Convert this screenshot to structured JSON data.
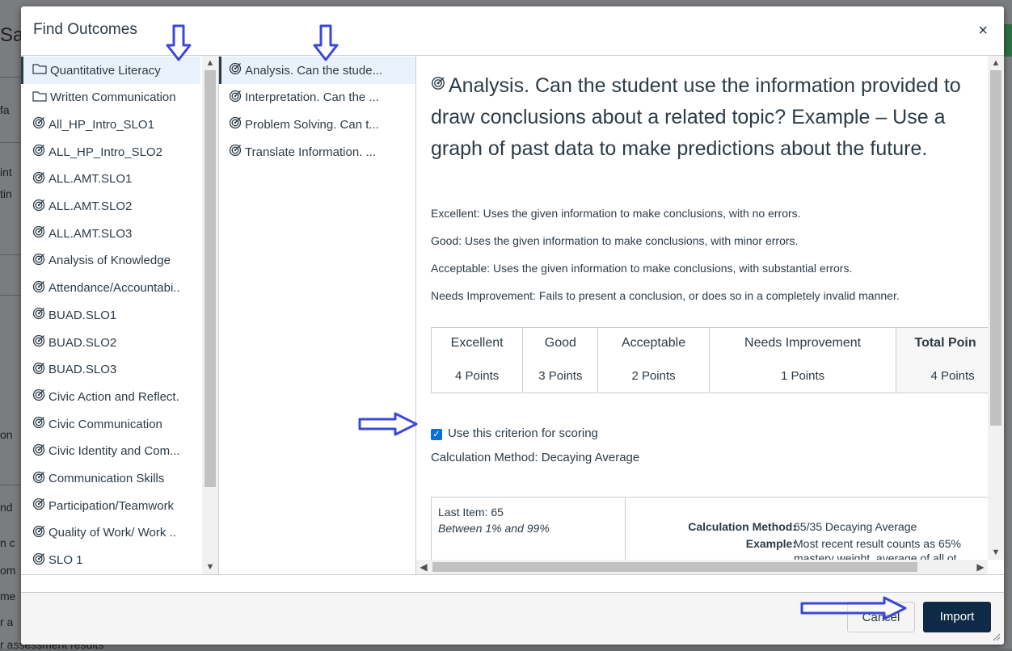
{
  "dialog": {
    "title": "Find Outcomes",
    "close": "×"
  },
  "groups": [
    {
      "label": "Quantitative Literacy",
      "type": "folder",
      "selected": true
    },
    {
      "label": "Written Communication",
      "type": "folder"
    },
    {
      "label": "All_HP_Intro_SLO1",
      "type": "outcome"
    },
    {
      "label": "ALL_HP_Intro_SLO2",
      "type": "outcome"
    },
    {
      "label": "ALL.AMT.SLO1",
      "type": "outcome"
    },
    {
      "label": "ALL.AMT.SLO2",
      "type": "outcome"
    },
    {
      "label": "ALL.AMT.SLO3",
      "type": "outcome"
    },
    {
      "label": "Analysis of Knowledge",
      "type": "outcome"
    },
    {
      "label": "Attendance/Accountabi..",
      "type": "outcome"
    },
    {
      "label": "BUAD.SLO1",
      "type": "outcome"
    },
    {
      "label": "BUAD.SLO2",
      "type": "outcome"
    },
    {
      "label": "BUAD.SLO3",
      "type": "outcome"
    },
    {
      "label": "Civic Action and Reflect.",
      "type": "outcome"
    },
    {
      "label": "Civic Communication",
      "type": "outcome"
    },
    {
      "label": "Civic Identity and Com...",
      "type": "outcome"
    },
    {
      "label": "Communication Skills",
      "type": "outcome"
    },
    {
      "label": "Participation/Teamwork",
      "type": "outcome"
    },
    {
      "label": "Quality of Work/ Work ..",
      "type": "outcome"
    },
    {
      "label": "SLO 1",
      "type": "outcome"
    }
  ],
  "outcomes": [
    {
      "label": "Analysis. Can the stude...",
      "selected": true
    },
    {
      "label": "Interpretation. Can the ..."
    },
    {
      "label": "Problem Solving. Can t..."
    },
    {
      "label": "Translate Information. ..."
    }
  ],
  "detail": {
    "title": "Analysis. Can the student use the information provided to draw conclusions about a related topic? Example – Use a graph of past data to make predictions about the future.",
    "ratings": [
      "Excellent: Uses the given information to make conclusions, with no errors.",
      "Good: Uses the given information to make conclusions, with minor errors.",
      "Acceptable: Uses the given information to make conclusions, with substantial errors.",
      "Needs Improvement: Fails to present a conclusion, or does so in a completely invalid manner."
    ],
    "rubric": [
      {
        "name": "Excellent",
        "points": "4 Points"
      },
      {
        "name": "Good",
        "points": "3 Points"
      },
      {
        "name": "Acceptable",
        "points": "2 Points"
      },
      {
        "name": "Needs Improvement",
        "points": "1 Points"
      },
      {
        "name": "Total Poin",
        "points": "4 Points"
      }
    ],
    "use_for_scoring": "Use this criterion for scoring",
    "use_for_scoring_checked": true,
    "calc_method": "Calculation Method: Decaying Average",
    "calc_box": {
      "last_item": "Last Item: 65",
      "range": "Between 1% and 99%",
      "method_label": "Calculation Method:",
      "method_value": "65/35 Decaying Average",
      "example_label": "Example:",
      "example_line1": "Most recent result counts as 65%",
      "example_line2": "mastery weight, average of all ot"
    }
  },
  "footer": {
    "cancel": "Cancel",
    "import": "Import"
  },
  "background_fragments": [
    "Sa",
    "fa",
    "int",
    "tin",
    "on",
    "nd",
    "n c",
    "om",
    "me",
    "r a",
    "r assessment results"
  ],
  "colors": {
    "primary_button": "#0e2a46",
    "selected_row": "#e9f2fa",
    "checkbox": "#0770dd",
    "annotation_arrow": "#3b47d9"
  }
}
